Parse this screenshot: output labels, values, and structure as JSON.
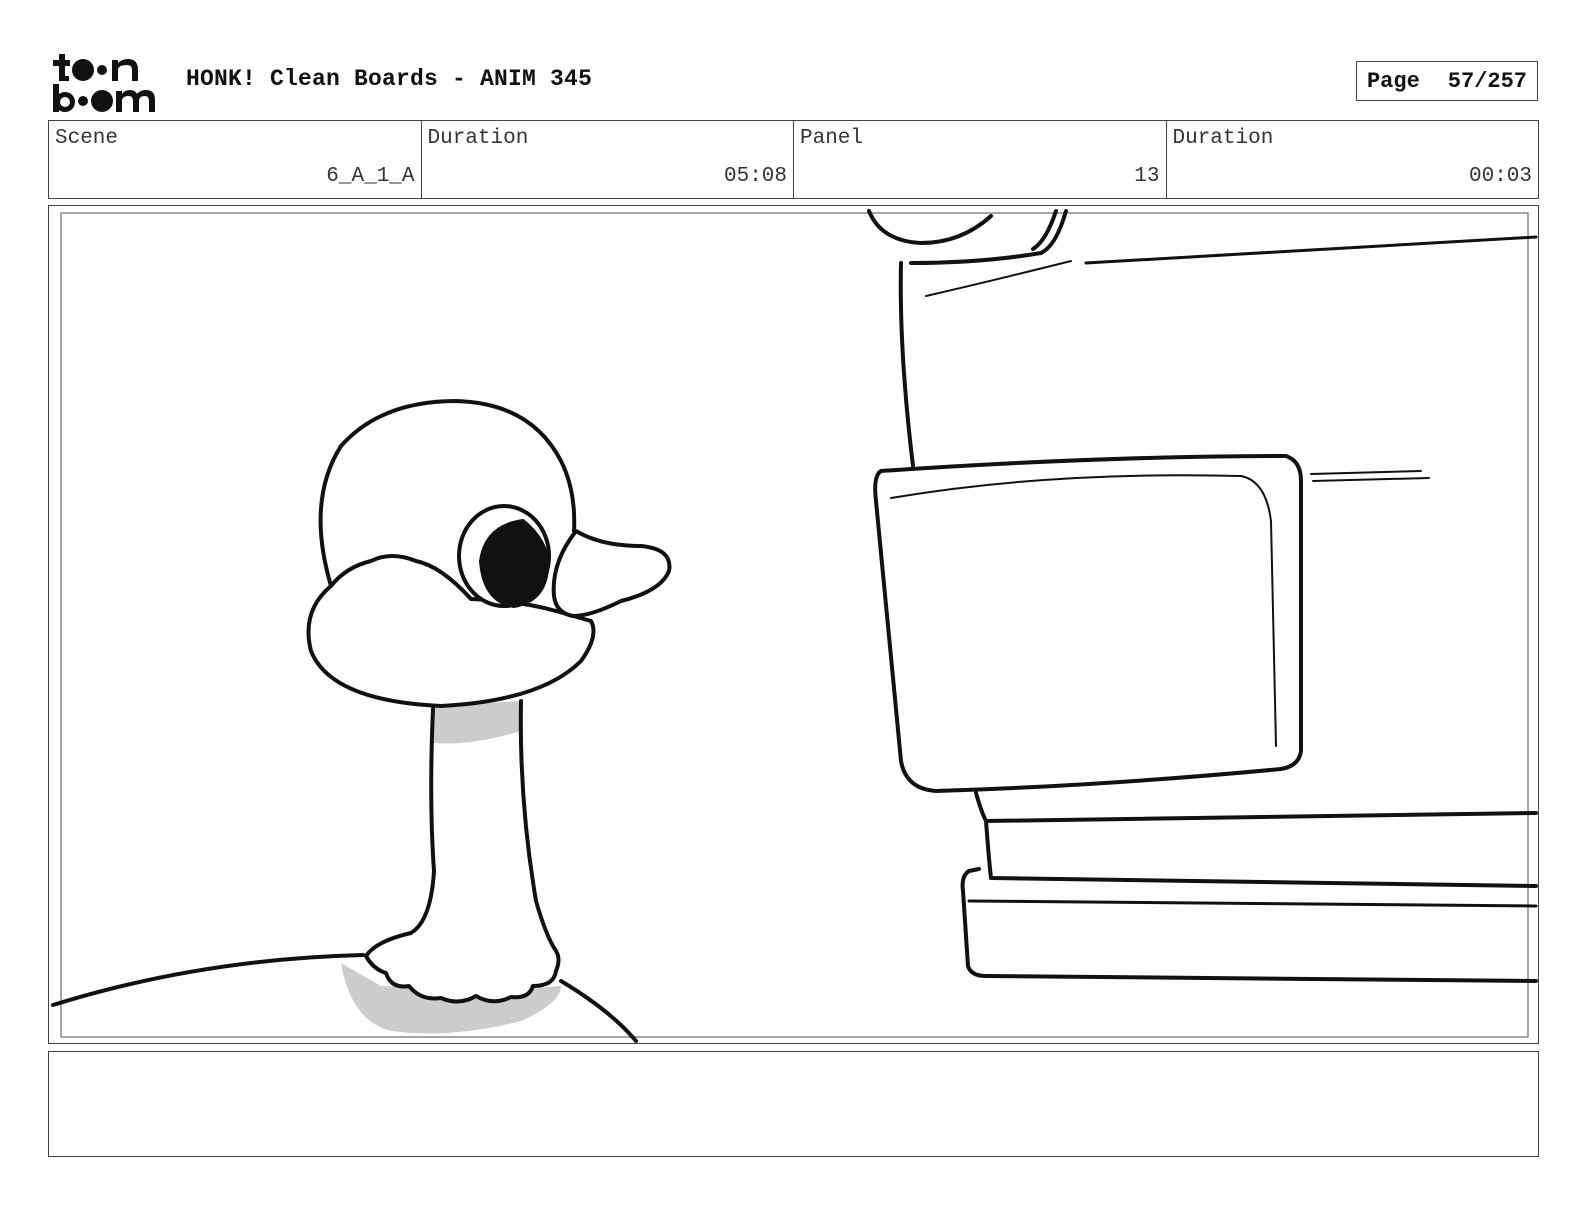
{
  "header": {
    "logo_text": "toon boom",
    "title": "HONK! Clean Boards - ANIM 345",
    "page_label": "Page",
    "page_value": "57/257"
  },
  "info": {
    "scene_label": "Scene",
    "scene_value": "6_A_1_A",
    "scene_duration_label": "Duration",
    "scene_duration_value": "05:08",
    "panel_label": "Panel",
    "panel_value": "13",
    "panel_duration_label": "Duration",
    "panel_duration_value": "00:03"
  },
  "notes": {
    "text": ""
  }
}
